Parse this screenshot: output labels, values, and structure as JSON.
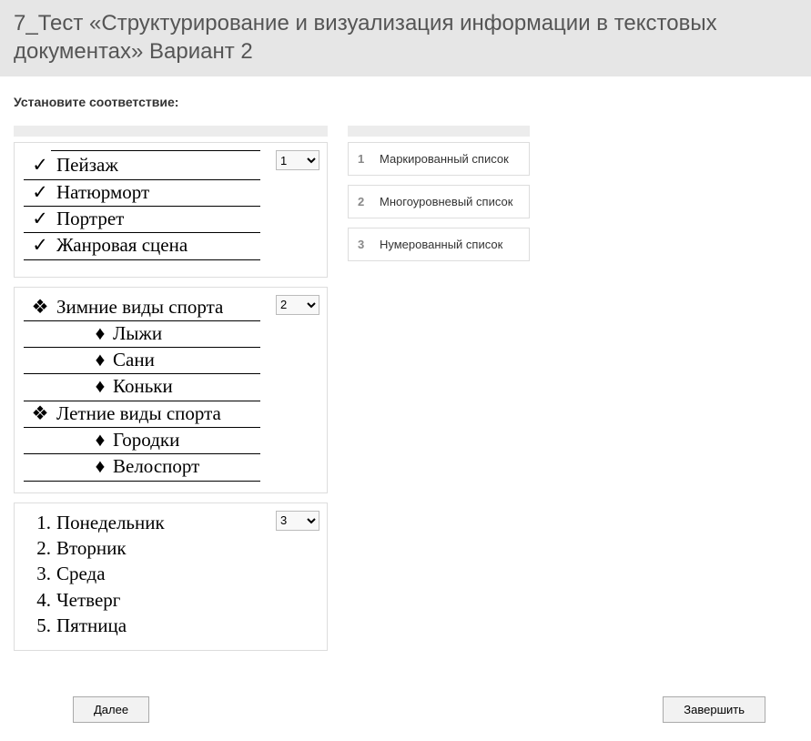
{
  "header": {
    "title": "7_Тест «Структурирование и визуализация информации в текстовых документах» Вариант 2"
  },
  "instruction": "Установите соответствие:",
  "cards": [
    {
      "selected": "1",
      "type": "check",
      "items": [
        "Пейзаж",
        "Натюрморт",
        "Портрет",
        "Жанровая сцена"
      ]
    },
    {
      "selected": "2",
      "type": "multilevel",
      "groups": [
        {
          "title": "Зимние виды спорта",
          "items": [
            "Лыжи",
            "Сани",
            "Коньки"
          ]
        },
        {
          "title": "Летние виды спорта",
          "items": [
            "Городки",
            "Велоспорт"
          ]
        }
      ]
    },
    {
      "selected": "3",
      "type": "numbered",
      "items": [
        "Понедельник",
        "Вторник",
        "Среда",
        "Четверг",
        "Пятница"
      ]
    }
  ],
  "select_options": [
    "1",
    "2",
    "3"
  ],
  "answers": [
    {
      "num": "1",
      "label": "Маркированный список"
    },
    {
      "num": "2",
      "label": "Многоуровневый список"
    },
    {
      "num": "3",
      "label": "Нумерованный список"
    }
  ],
  "buttons": {
    "next": "Далее",
    "finish": "Завершить"
  }
}
